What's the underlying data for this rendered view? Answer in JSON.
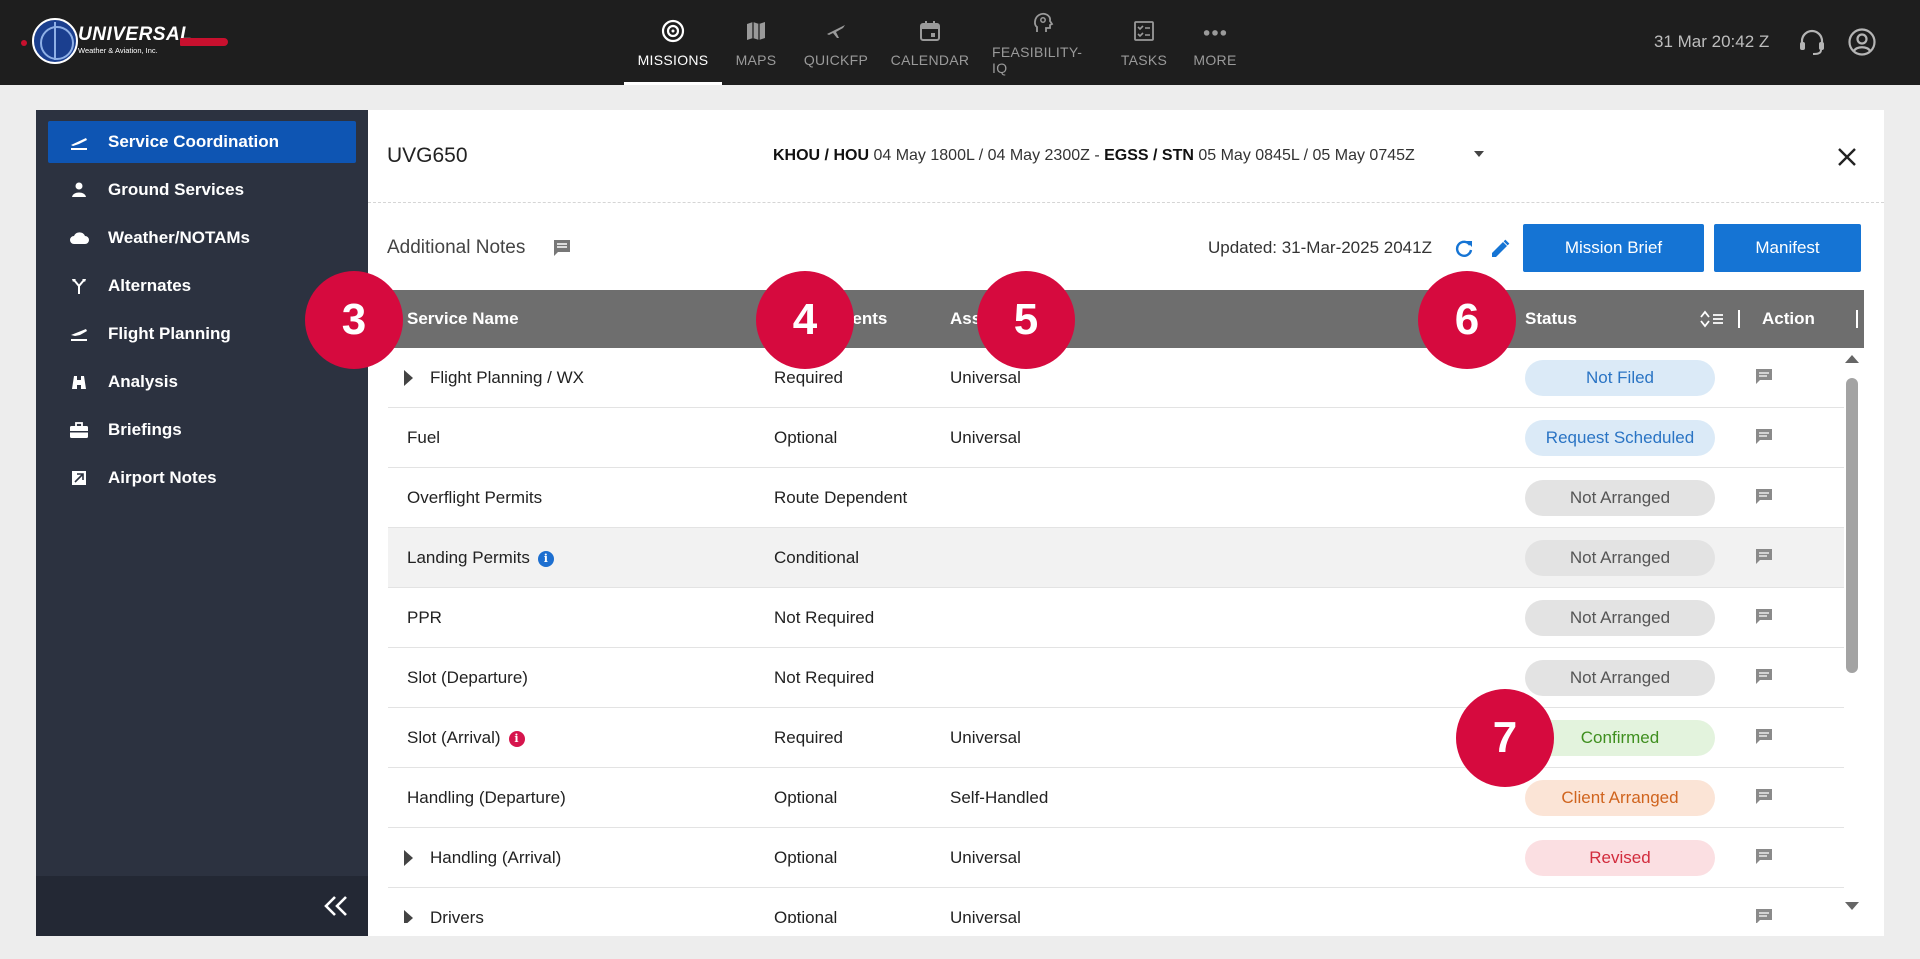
{
  "brand": {
    "name": "UNIVERSAL",
    "sub": "Weather & Aviation, Inc."
  },
  "nav": [
    {
      "label": "MISSIONS",
      "icon": "target-icon",
      "active": true
    },
    {
      "label": "MAPS",
      "icon": "map-icon"
    },
    {
      "label": "QUICKFP",
      "icon": "plane-icon"
    },
    {
      "label": "CALENDAR",
      "icon": "calendar-icon"
    },
    {
      "label": "FEASIBILITY-IQ",
      "icon": "brain-head-icon"
    },
    {
      "label": "TASKS",
      "icon": "checklist-icon"
    },
    {
      "label": "MORE",
      "icon": "more-dots-icon"
    }
  ],
  "clock": "31 Mar 20:42 Z",
  "sidebar": {
    "items": [
      {
        "label": "Service Coordination",
        "icon": "plane-takeoff-icon",
        "active": true
      },
      {
        "label": "Ground Services",
        "icon": "person-icon"
      },
      {
        "label": "Weather/NOTAMs",
        "icon": "cloud-icon"
      },
      {
        "label": "Alternates",
        "icon": "fork-icon"
      },
      {
        "label": "Flight Planning",
        "icon": "flight-icon"
      },
      {
        "label": "Analysis",
        "icon": "binoculars-icon"
      },
      {
        "label": "Briefings",
        "icon": "briefcase-icon"
      },
      {
        "label": "Airport Notes",
        "icon": "note-icon"
      }
    ]
  },
  "mission": {
    "id": "UVG650",
    "route": {
      "dep_codes": "KHOU / HOU",
      "dep_times": "04 May 1800L / 04 May 2300Z -",
      "arr_codes": "EGSS / STN",
      "arr_times": "05 May 0845L / 05 May 0745Z"
    },
    "notes_label": "Additional Notes",
    "updated": "Updated: 31-Mar-2025 2041Z",
    "buttons": {
      "mission_brief": "Mission Brief",
      "manifest": "Manifest"
    }
  },
  "table": {
    "headers": {
      "service": "Service Name",
      "requirements": "Requirements",
      "assignment": "Assignment",
      "status": "Status",
      "action": "Action"
    },
    "rows": [
      {
        "service": "Flight Planning / WX",
        "requirement": "Required",
        "assignment": "Universal",
        "status": "Not Filed",
        "expandable": true
      },
      {
        "service": "Fuel",
        "requirement": "Optional",
        "assignment": "Universal",
        "status": "Request Scheduled"
      },
      {
        "service": "Overflight Permits",
        "requirement": "Route Dependent",
        "assignment": "",
        "status": "Not Arranged"
      },
      {
        "service": "Landing Permits",
        "requirement": "Conditional",
        "assignment": "",
        "status": "Not Arranged",
        "info": "blue",
        "highlight": true
      },
      {
        "service": "PPR",
        "requirement": "Not Required",
        "assignment": "",
        "status": "Not Arranged"
      },
      {
        "service": "Slot (Departure)",
        "requirement": "Not Required",
        "assignment": "",
        "status": "Not Arranged"
      },
      {
        "service": "Slot (Arrival)",
        "requirement": "Required",
        "assignment": "Universal",
        "status": "Confirmed",
        "info": "red"
      },
      {
        "service": "Handling (Departure)",
        "requirement": "Optional",
        "assignment": "Self-Handled",
        "status": "Client Arranged"
      },
      {
        "service": "Handling (Arrival)",
        "requirement": "Optional",
        "assignment": "Universal",
        "status": "Revised",
        "expandable": true
      },
      {
        "service": "Drivers",
        "requirement": "Optional",
        "assignment": "Universal",
        "status": "",
        "expandable": true
      }
    ]
  },
  "markers": [
    "3",
    "4",
    "5",
    "6",
    "7"
  ],
  "colors": {
    "accent": "#1574d4",
    "marker": "#d60a3e",
    "topbar": "#1e1e1e",
    "sidebar": "#2c3240"
  }
}
